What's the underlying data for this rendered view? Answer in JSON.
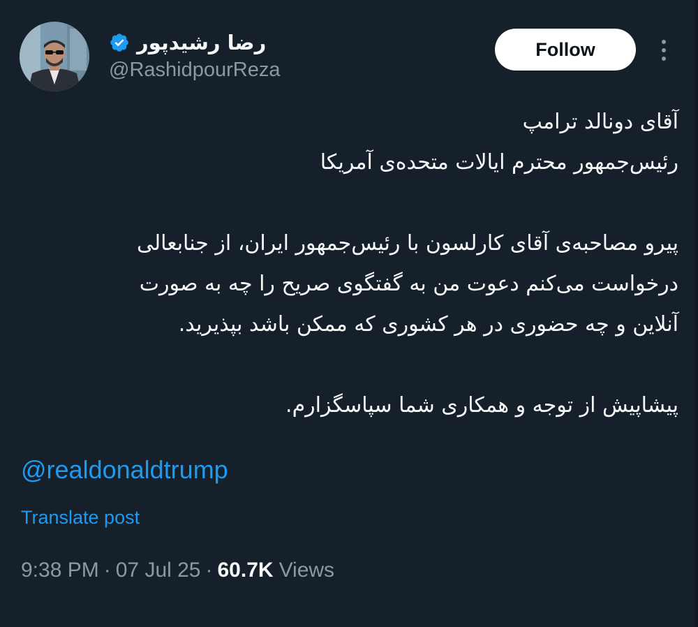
{
  "author": {
    "display_name": "رضا رشیدپور",
    "handle": "@RashidpourReza",
    "verified": true,
    "verified_color": "#1d9bf0"
  },
  "actions": {
    "follow_label": "Follow",
    "more_icon": "more-vertical-icon"
  },
  "tweet": {
    "lines": [
      "آقای دونالد ترامپ",
      "رئیس‌جمهور محترم ایالات متحده‌ی آمریکا",
      "",
      "پیرو مصاحبه‌ی آقای کارلسون با رئیس‌جمهور ایران، از جنابعالی",
      "درخواست می‌کنم دعوت من به گفتگوی صریح را چه به صورت",
      "آنلاین و چه حضوری در هر کشوری که ممکن باشد بپذیرید.",
      "",
      "پیشاپیش از توجه و همکاری شما سپاسگزارم."
    ],
    "mention": "@realdonaldtrump",
    "translate_label": "Translate post"
  },
  "meta": {
    "time": "9:38 PM",
    "separator": "·",
    "date": "07 Jul 25",
    "views_count": "60.7K",
    "views_label": "Views"
  },
  "colors": {
    "background": "#15202b",
    "text": "#f7f9f9",
    "secondary": "#8b98a5",
    "link": "#1d9bf0"
  }
}
